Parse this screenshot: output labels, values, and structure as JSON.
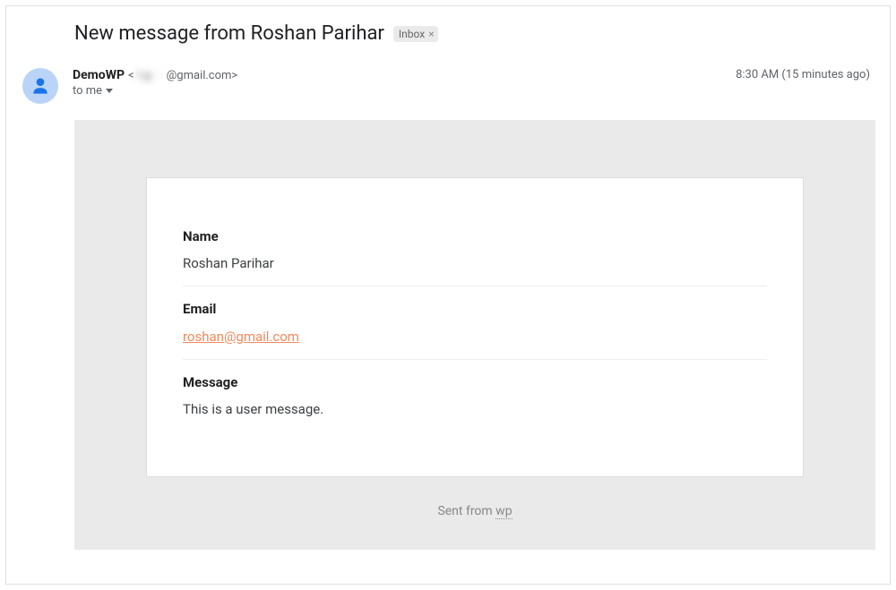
{
  "subject": {
    "text": "New message from Roshan Parihar",
    "chip_label": "Inbox"
  },
  "sender": {
    "name": "DemoWP",
    "email_prefix": "<",
    "email_blurred": "t   g   ·  · ",
    "email_suffix": "@gmail.com>",
    "to_label": "to me"
  },
  "meta": {
    "time": "8:30 AM (15 minutes ago)"
  },
  "form": {
    "name_label": "Name",
    "name_value": "Roshan Parihar",
    "email_label": "Email",
    "email_value": "roshan@gmail.com",
    "message_label": "Message",
    "message_value": "This is a user message."
  },
  "footer": {
    "sent_from": "Sent from ",
    "wp": "wp"
  }
}
